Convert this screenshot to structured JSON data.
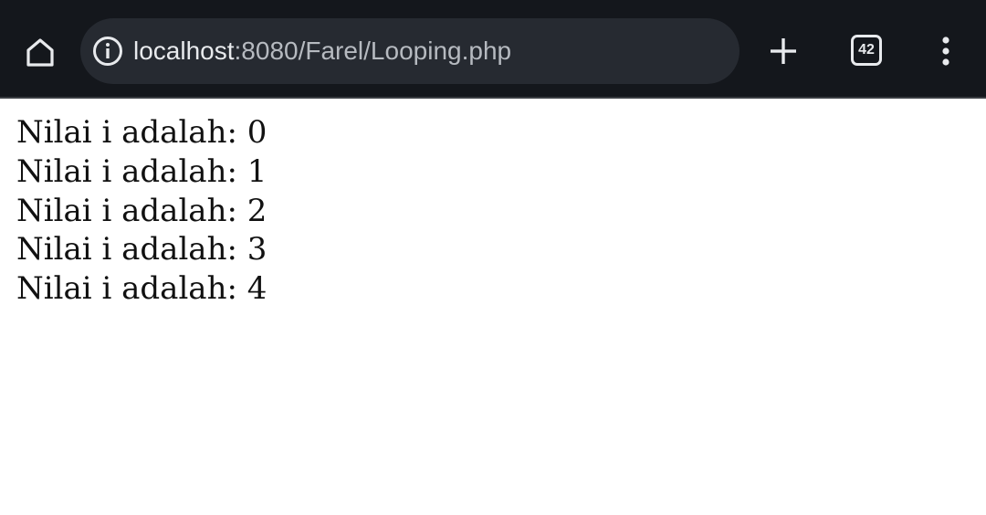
{
  "browser": {
    "url_host": "localhost",
    "url_rest": ":8080/Farel/Looping.php",
    "tab_count": "42",
    "icons": {
      "home": "home-icon",
      "site_info": "info-icon",
      "new_tab": "plus-icon",
      "tabs": "tab-switcher-icon",
      "menu": "more-vert-icon"
    },
    "colors": {
      "toolbar_bg": "#14171c",
      "omnibox_bg": "#262a31",
      "icon": "#e8eaed"
    }
  },
  "page": {
    "lines": [
      "Nilai i adalah: 0",
      "Nilai i adalah: 1",
      "Nilai i adalah: 2",
      "Nilai i adalah: 3",
      "Nilai i adalah: 4"
    ]
  }
}
